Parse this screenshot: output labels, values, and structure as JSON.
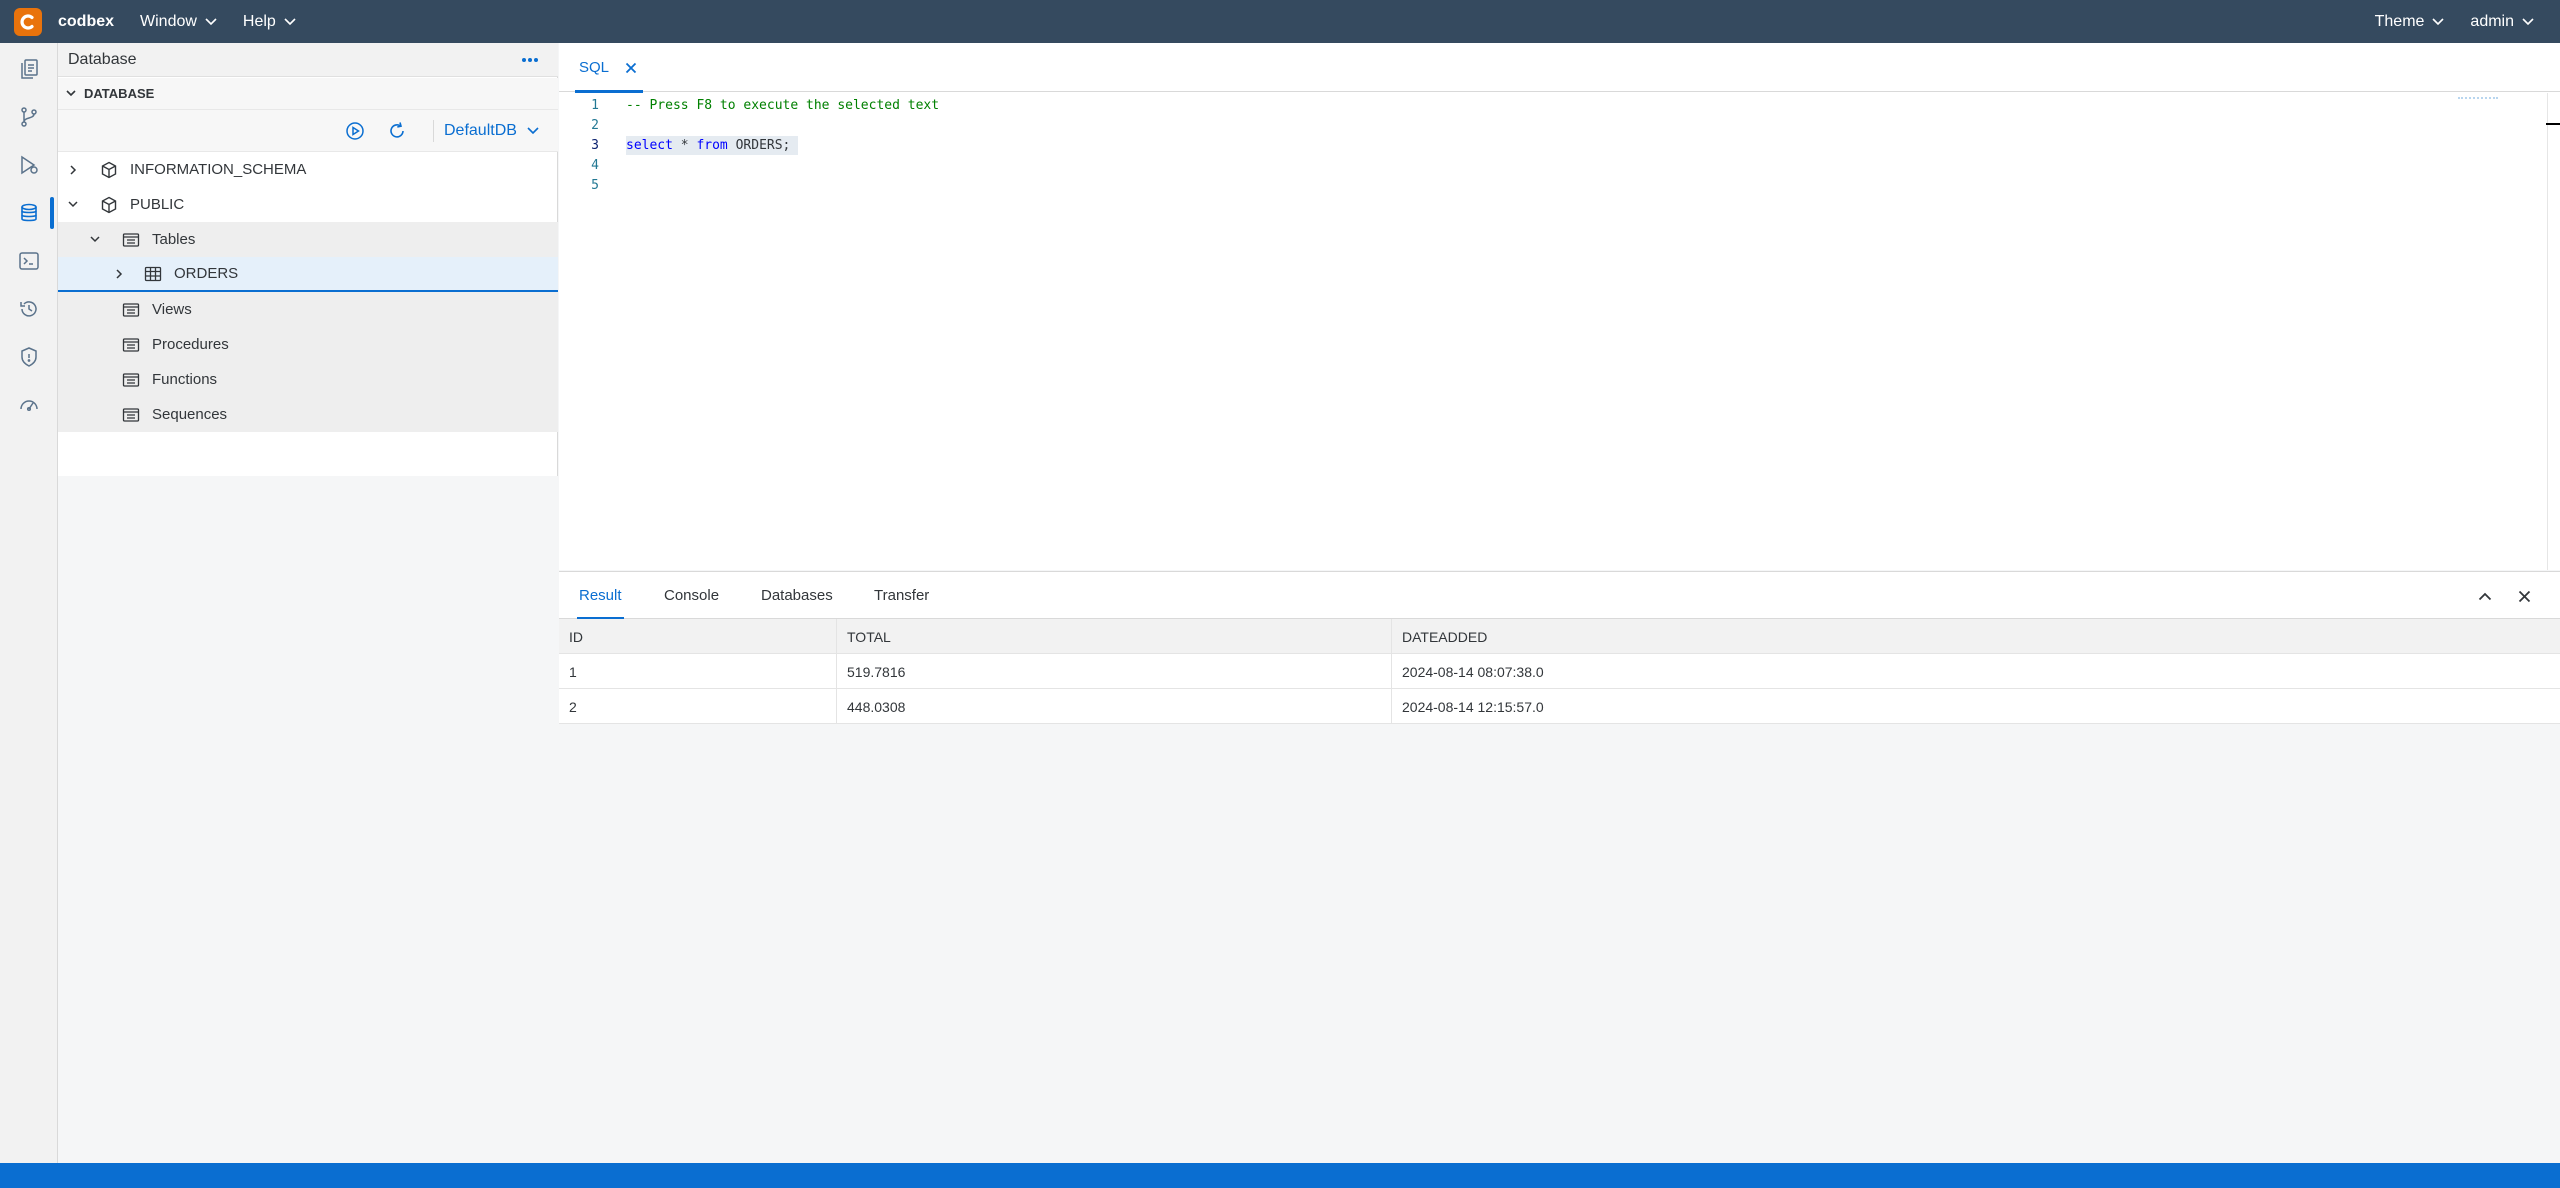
{
  "app": {
    "brand": "codbex"
  },
  "topbar": {
    "menus": [
      "Window",
      "Help"
    ],
    "right_menus": [
      "Theme",
      "admin"
    ]
  },
  "rail": {
    "items": [
      "documents-icon",
      "git-branch-icon",
      "deploy-icon",
      "database-icon",
      "terminal-icon",
      "history-icon",
      "security-icon",
      "dashboard-icon"
    ],
    "active": "database-icon"
  },
  "db_panel": {
    "title": "Database",
    "section": "DATABASE",
    "selected_db": "DefaultDB",
    "tree": [
      {
        "label": "INFORMATION_SCHEMA",
        "level": 0,
        "expanded": false
      },
      {
        "label": "PUBLIC",
        "level": 0,
        "expanded": true
      },
      {
        "label": "Tables",
        "level": 1,
        "expanded": true
      },
      {
        "label": "ORDERS",
        "level": 2,
        "expanded": false,
        "selected": true
      },
      {
        "label": "Views",
        "level": 1
      },
      {
        "label": "Procedures",
        "level": 1
      },
      {
        "label": "Functions",
        "level": 1
      },
      {
        "label": "Sequences",
        "level": 1
      }
    ]
  },
  "editor": {
    "tab_label": "SQL",
    "lines": [
      {
        "num": "1",
        "text": "-- Press F8 to execute the selected text"
      },
      {
        "num": "2",
        "text": ""
      },
      {
        "num": "3",
        "kw1": "select",
        "op": " * ",
        "kw2": "from",
        "rest": " ORDERS;"
      },
      {
        "num": "4",
        "text": ""
      },
      {
        "num": "5",
        "text": ""
      }
    ]
  },
  "results": {
    "tabs": [
      "Result",
      "Console",
      "Databases",
      "Transfer"
    ],
    "active_tab": "Result",
    "columns": [
      "ID",
      "TOTAL",
      "DATEADDED"
    ],
    "rows": [
      [
        "1",
        "519.7816",
        "2024-08-14 08:07:38.0"
      ],
      [
        "2",
        "448.0308",
        "2024-08-14 12:15:57.0"
      ]
    ]
  },
  "colors": {
    "topbar": "#354a5f",
    "accent": "#0a6ed1",
    "logo": "#e9730c",
    "statusbar": "#0a6ed1"
  }
}
